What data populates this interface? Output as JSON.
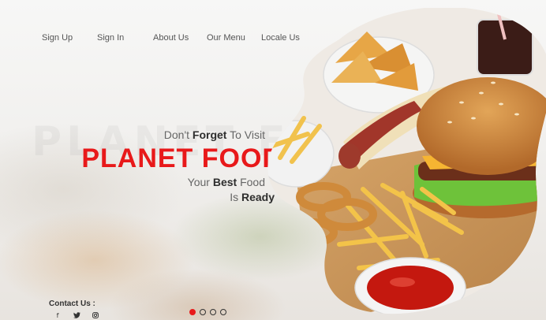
{
  "nav": {
    "items": [
      {
        "label": "Sign Up"
      },
      {
        "label": "Sign In"
      },
      {
        "label": "About Us"
      },
      {
        "label": "Our Menu"
      },
      {
        "label": "Locale Us"
      }
    ]
  },
  "hero": {
    "watermark": "PLANET FOOD",
    "line1_pre": "Don't ",
    "line1_bold": "Forget",
    "line1_post": " To Visit",
    "brand": "PLANET FOOD",
    "line2_pre": "Your ",
    "line2_bold": "Best",
    "line2_post": " Food",
    "line3_pre": "Is ",
    "line3_bold": "Ready"
  },
  "contact": {
    "label": "Contact Us :",
    "socials": [
      {
        "icon": "facebook-icon",
        "glyph": "f"
      },
      {
        "icon": "twitter-icon",
        "glyph": "🐦"
      },
      {
        "icon": "instagram-icon",
        "glyph": "◎"
      }
    ]
  },
  "carousel": {
    "slides": 4,
    "active_index": 0
  },
  "colors": {
    "brand_red": "#e8191a",
    "text_dark": "#2e2e2e",
    "text_muted": "#666666"
  }
}
